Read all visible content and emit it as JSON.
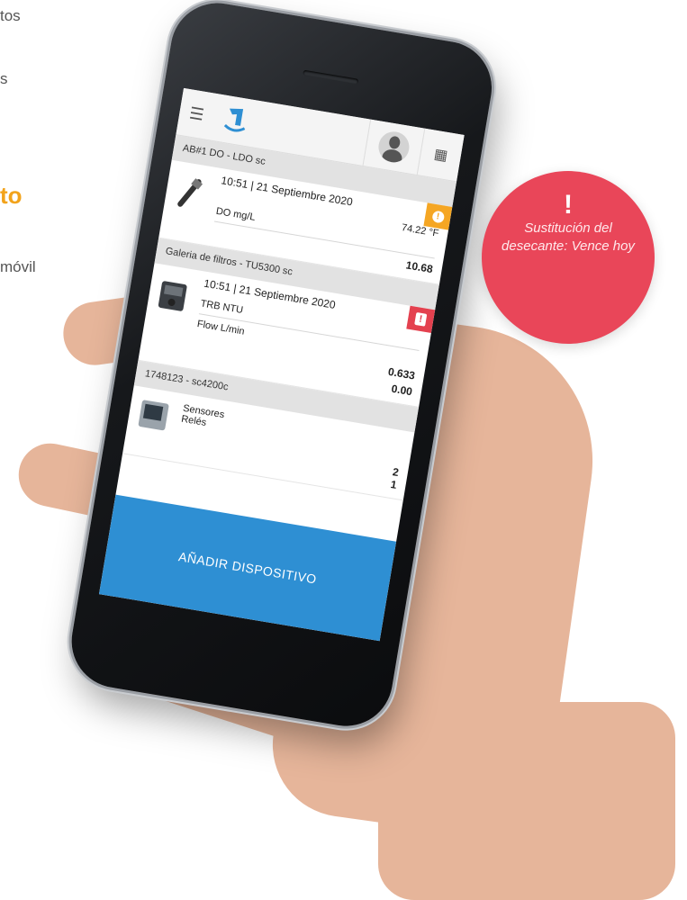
{
  "background": {
    "text_fragments": [
      "tos",
      "s",
      "móvil"
    ],
    "heading_fragment": "to"
  },
  "app": {
    "menu_icon": "hamburger-icon",
    "logo_icon": "hach-app-logo-icon",
    "avatar_icon": "user-avatar-icon",
    "apps_icon": "grid-icon"
  },
  "devices": [
    {
      "title": "AB#1 DO - LDO sc",
      "timestamp": "10:51 | 21 Septiembre 2020",
      "status": "warning",
      "rows": [
        {
          "label": "",
          "value": "74.22 °F"
        },
        {
          "label": "DO mg/L",
          "value": "10.68"
        }
      ]
    },
    {
      "title": "Galeria de filtros - TU5300 sc",
      "timestamp": "10:51 | 21 Septiembre 2020",
      "status": "error",
      "rows": [
        {
          "label": "TRB NTU",
          "value": "0.633"
        },
        {
          "label": "Flow L/min",
          "value": "0.00"
        }
      ]
    },
    {
      "title": "1748123 - sc4200c",
      "timestamp": "",
      "status": "none",
      "rows": [
        {
          "label": "Sensores",
          "value": "2"
        },
        {
          "label": "Relés",
          "value": "1"
        }
      ]
    }
  ],
  "add_button_label": "AÑADIR DISPOSITIVO",
  "notification": {
    "mark": "!",
    "message": "Sustitución del desecante: Vence hoy"
  },
  "colors": {
    "accent_blue": "#2e8fd3",
    "warning": "#f5a623",
    "error": "#e4414f",
    "notification": "#e94659",
    "heading_orange": "#f2a31b"
  }
}
